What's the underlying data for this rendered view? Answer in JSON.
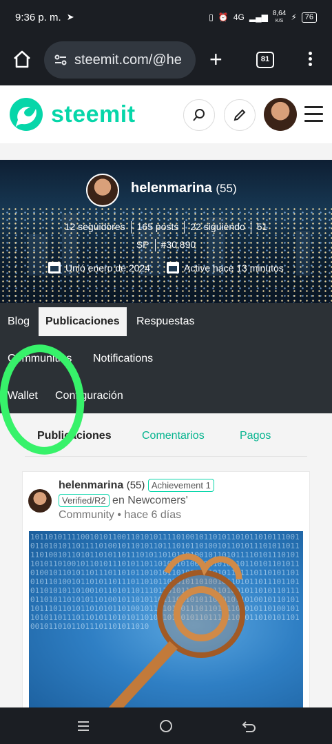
{
  "status_bar": {
    "time": "9:36 p. m.",
    "network": "4G",
    "speed": "8,64",
    "speed_unit": "K/S",
    "battery": "76"
  },
  "browser": {
    "url": "steemit.com/@he",
    "tab_count": "81"
  },
  "site": {
    "logo_text": "steemit",
    "brand_color": "#06d6a9"
  },
  "profile": {
    "username": "helenmarina",
    "reputation": "(55)",
    "followers": "12 seguidores",
    "posts": "165 posts",
    "following": "22 siguiendo",
    "sp_value": "51",
    "sp_label": "SP",
    "rank": "#30,890",
    "joined": "Unió enero de 2024",
    "active": "Active hace 13 minutos"
  },
  "nav": {
    "blog": "Blog",
    "publicaciones": "Publicaciones",
    "respuestas": "Respuestas",
    "communities": "Communities",
    "notifications": "Notifications",
    "wallet": "Wallet",
    "configuracion": "Configuración"
  },
  "sub_tabs": {
    "publicaciones": "Publicaciones",
    "comentarios": "Comentarios",
    "pagos": "Pagos"
  },
  "post": {
    "author": "helenmarina",
    "reputation": "(55)",
    "badge1": "Achievement 1",
    "badge2": "Verified/R2",
    "community_prefix": "en Newcomers'",
    "community_suffix": "Community",
    "time": "• hace 6 días"
  },
  "icons": [
    "home-icon",
    "site-settings-icon",
    "plus-icon",
    "tabs-icon",
    "more-icon",
    "search-icon",
    "pencil-icon",
    "calendar-icon",
    "menu-icon",
    "back-icon"
  ]
}
